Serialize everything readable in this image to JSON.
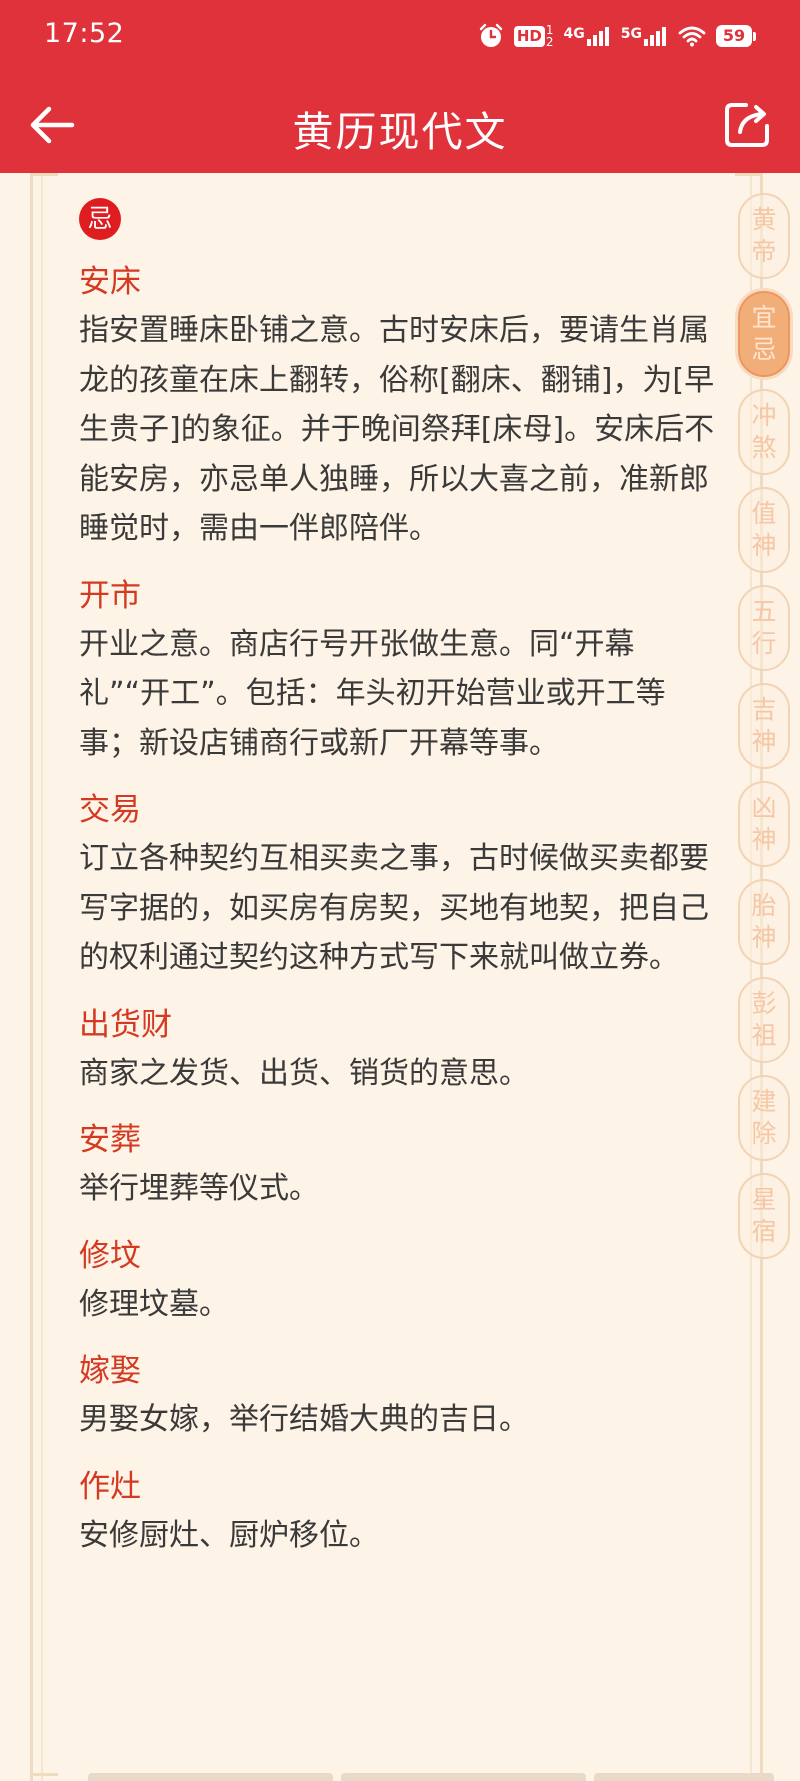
{
  "status_bar": {
    "time": "17:52",
    "battery": "59",
    "network_1": "4G",
    "network_2": "5G",
    "hd_label": "HD"
  },
  "header": {
    "title": "黄历现代文",
    "bg_color": "#e0323b"
  },
  "section": {
    "badge": "忌"
  },
  "entries": [
    {
      "term": "安床",
      "desc": "指安置睡床卧铺之意。古时安床后，要请生肖属龙的孩童在床上翻转，俗称[翻床、翻铺]，为[早生贵子]的象征。并于晚间祭拜[床母]。安床后不能安房，亦忌单人独睡，所以大喜之前，准新郎睡觉时，需由一伴郎陪伴。"
    },
    {
      "term": "开市",
      "desc": "开业之意。商店行号开张做生意。同“开幕礼”“开工”。包括：年头初开始营业或开工等事；新设店铺商行或新厂开幕等事。"
    },
    {
      "term": "交易",
      "desc": "订立各种契约互相买卖之事，古时候做买卖都要写字据的，如买房有房契，买地有地契，把自己的权利通过契约这种方式写下来就叫做立券。"
    },
    {
      "term": "出货财",
      "desc": "商家之发货、出货、销货的意思。"
    },
    {
      "term": "安葬",
      "desc": "举行埋葬等仪式。"
    },
    {
      "term": "修坟",
      "desc": "修理坟墓。"
    },
    {
      "term": "嫁娶",
      "desc": "男娶女嫁，举行结婚大典的吉日。"
    },
    {
      "term": "作灶",
      "desc": "安修厨灶、厨炉移位。"
    }
  ],
  "side_nav": [
    {
      "label": "黄帝",
      "active": false
    },
    {
      "label": "宜忌",
      "active": true
    },
    {
      "label": "冲煞",
      "active": false
    },
    {
      "label": "值神",
      "active": false
    },
    {
      "label": "五行",
      "active": false
    },
    {
      "label": "吉神",
      "active": false
    },
    {
      "label": "凶神",
      "active": false
    },
    {
      "label": "胎神",
      "active": false
    },
    {
      "label": "彭祖",
      "active": false
    },
    {
      "label": "建除",
      "active": false
    },
    {
      "label": "星宿",
      "active": false
    }
  ],
  "icons": {
    "back": "arrow-left-icon",
    "share": "share-export-icon",
    "alarm": "alarm-icon",
    "wifi": "wifi-icon"
  },
  "colors": {
    "term_color": "#d43a21",
    "badge_color": "#df1c20",
    "active_nav": "#f2ae79"
  }
}
